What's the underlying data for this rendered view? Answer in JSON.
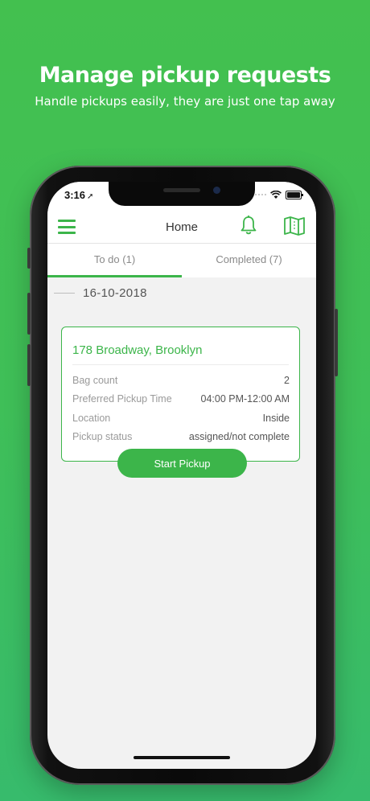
{
  "marketing": {
    "headline": "Manage pickup requests",
    "subline": "Handle pickups easily, they are just one tap away"
  },
  "status_bar": {
    "time": "3:16",
    "location_icon": "location-arrow-icon",
    "wifi_icon": "wifi-icon",
    "battery_icon": "battery-icon"
  },
  "navbar": {
    "title": "Home",
    "menu_icon": "hamburger-menu-icon",
    "notifications_icon": "bell-icon",
    "map_icon": "map-icon"
  },
  "tabs": [
    {
      "label": "To do (1)",
      "selected": true
    },
    {
      "label": "Completed (7)",
      "selected": false
    }
  ],
  "date_header": "16-10-2018",
  "pickup_card": {
    "address": "178 Broadway, Brooklyn",
    "rows": [
      {
        "label": "Bag count",
        "value": "2"
      },
      {
        "label": "Preferred Pickup Time",
        "value": "04:00 PM-12:00 AM"
      },
      {
        "label": "Location",
        "value": "Inside"
      },
      {
        "label": "Pickup status",
        "value": "assigned/not complete"
      }
    ],
    "action_label": "Start Pickup"
  },
  "colors": {
    "background_green": "#43c04f",
    "accent_green": "#3cb54a",
    "screen_background": "#f2f2f2"
  }
}
